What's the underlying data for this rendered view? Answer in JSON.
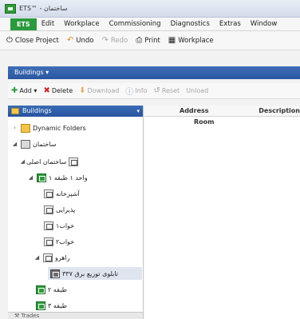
{
  "window": {
    "title": "ETS™ - ساختمان"
  },
  "menu": {
    "ets": "ETS",
    "items": [
      "Edit",
      "Workplace",
      "Commissioning",
      "Diagnostics",
      "Extras",
      "Window"
    ]
  },
  "toolbar": {
    "close_project": "Close Project",
    "undo": "Undo",
    "redo": "Redo",
    "print": "Print",
    "workplace": "Workplace"
  },
  "breadcrumb": {
    "label": "Buildings"
  },
  "actions": {
    "add": "Add",
    "delete": "Delete",
    "download": "Download",
    "info": "Info",
    "reset": "Reset",
    "unload": "Unload"
  },
  "tree": {
    "header": "Buildings",
    "items": {
      "dynamic_folders": "Dynamic Folders",
      "building": "ساختمان",
      "building_main": "ساختمان اصلی",
      "floor1": "واحد ۱ طبقه ۱",
      "room_kitchen": "آشپزخانه",
      "room_bath": "پذیرایی",
      "room_bed1": "خواب۱",
      "room_bed2": "خواب۲",
      "corridor": "راهرو",
      "distribution_board": "تابلوی توزیع برق ۳۳۷",
      "floor2": "طبقه ۲",
      "floor3": "طبقه ۳",
      "trades": "Trades"
    }
  },
  "table": {
    "columns": [
      "Address",
      "Room",
      "Description"
    ]
  },
  "colors": {
    "accent_blue": "#2a56a0",
    "ets_green": "#2b9a3e"
  }
}
